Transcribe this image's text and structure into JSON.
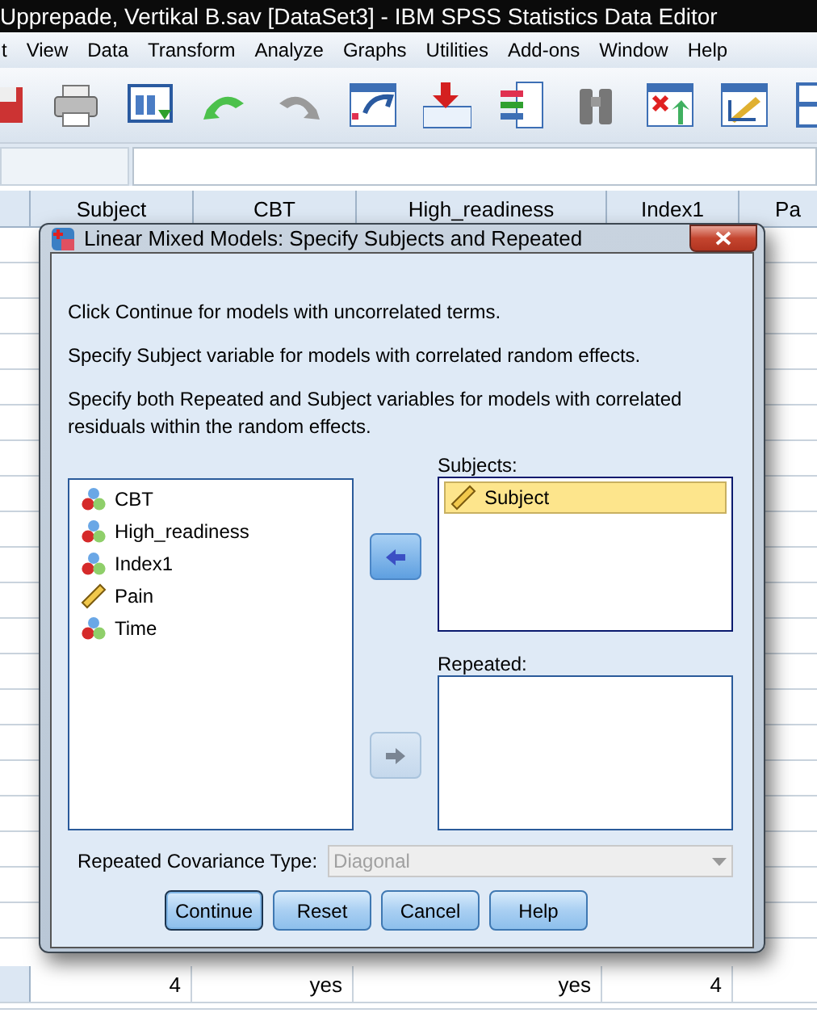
{
  "window": {
    "title": "Upprepade, Vertikal B.sav [DataSet3] - IBM SPSS Statistics Data Editor"
  },
  "menu": [
    "t",
    "View",
    "Data",
    "Transform",
    "Analyze",
    "Graphs",
    "Utilities",
    "Add-ons",
    "Window",
    "Help"
  ],
  "grid": {
    "columns": [
      "Subject",
      "CBT",
      "High_readiness",
      "Index1",
      "Pa"
    ],
    "rows": [
      {
        "cells": [
          "4",
          "yes",
          "yes",
          "4"
        ]
      }
    ]
  },
  "dialog": {
    "title": "Linear Mixed Models: Specify Subjects and Repeated",
    "instructions": [
      "Click Continue for models with uncorrelated terms.",
      "Specify Subject variable for models with correlated random effects.",
      "Specify both Repeated and Subject variables for models with correlated residuals within the random effects."
    ],
    "variables": [
      {
        "name": "CBT",
        "kind": "nominal"
      },
      {
        "name": "High_readiness",
        "kind": "nominal"
      },
      {
        "name": "Index1",
        "kind": "nominal"
      },
      {
        "name": "Pain",
        "kind": "scale"
      },
      {
        "name": "Time",
        "kind": "nominal"
      }
    ],
    "subjects": {
      "label": "Subjects:",
      "items": [
        {
          "name": "Subject",
          "kind": "scale",
          "selected": true
        }
      ]
    },
    "repeated": {
      "label": "Repeated:"
    },
    "move_buttons": [
      {
        "kind": "left",
        "disabled": false
      },
      {
        "kind": "right",
        "disabled": true
      }
    ],
    "covariance": {
      "label": "Repeated Covariance Type:",
      "value": "Diagonal",
      "disabled": true
    },
    "buttons": [
      {
        "label": "Continue",
        "default": true
      },
      {
        "label": "Reset",
        "default": false
      },
      {
        "label": "Cancel",
        "default": false
      },
      {
        "label": "Help",
        "default": false
      }
    ]
  }
}
